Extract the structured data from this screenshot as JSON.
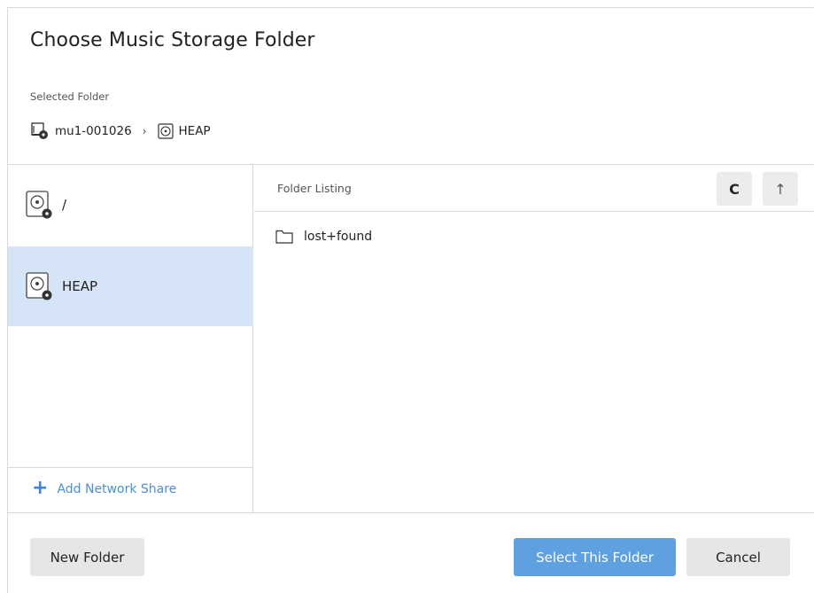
{
  "dialog": {
    "title": "Choose Music Storage Folder",
    "selected_label": "Selected Folder",
    "breadcrumb": [
      {
        "label": "mu1-001026",
        "icon": "server-icon"
      },
      {
        "label": "HEAP",
        "icon": "disk-icon"
      }
    ],
    "breadcrumb_separator": "›"
  },
  "sidebar": {
    "devices": [
      {
        "label": "/",
        "icon": "drive-icon",
        "selected": false
      },
      {
        "label": "HEAP",
        "icon": "drive-icon",
        "selected": true
      }
    ],
    "add_share_label": "Add Network Share"
  },
  "listing": {
    "header": "Folder Listing",
    "refresh_glyph": "C",
    "up_glyph": "↑",
    "folders": [
      {
        "name": "lost+found",
        "icon": "folder-icon"
      }
    ]
  },
  "footer": {
    "new_folder": "New Folder",
    "select": "Select This Folder",
    "cancel": "Cancel"
  },
  "colors": {
    "accent": "#5fa0e0",
    "link": "#4a8fd8",
    "selected_bg": "#d5e5f7"
  }
}
